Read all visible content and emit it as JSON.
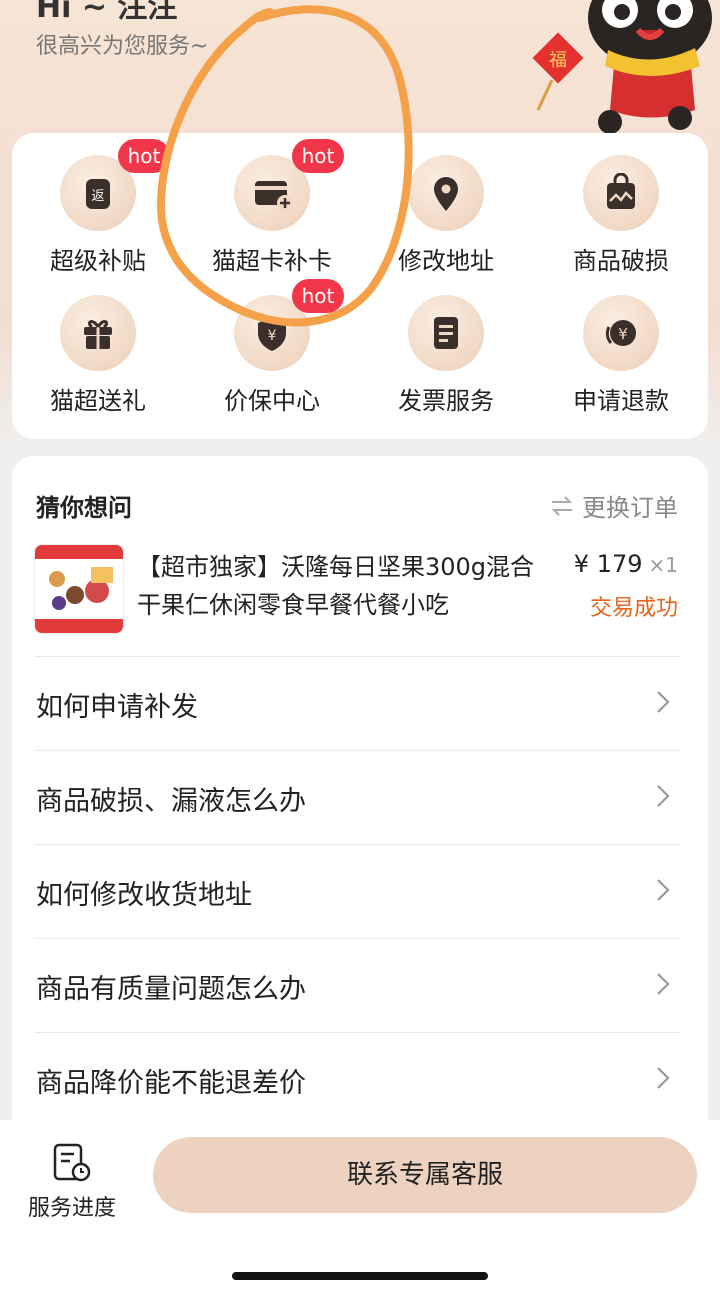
{
  "header": {
    "title_partial": "Hi  ~ 注注",
    "subtitle": "很高兴为您服务~"
  },
  "services": [
    {
      "label": "超级补贴",
      "icon": "subsidy-icon",
      "badge": "hot"
    },
    {
      "label": "猫超卡补卡",
      "icon": "card-add-icon",
      "badge": "hot"
    },
    {
      "label": "修改地址",
      "icon": "location-pin-icon",
      "badge": ""
    },
    {
      "label": "商品破损",
      "icon": "broken-bag-icon",
      "badge": ""
    },
    {
      "label": "猫超送礼",
      "icon": "gift-icon",
      "badge": ""
    },
    {
      "label": "价保中心",
      "icon": "price-protect-icon",
      "badge": "hot"
    },
    {
      "label": "发票服务",
      "icon": "invoice-icon",
      "badge": ""
    },
    {
      "label": "申请退款",
      "icon": "refund-icon",
      "badge": ""
    }
  ],
  "guess": {
    "title": "猜你想问",
    "change_label": "更换订单",
    "product": {
      "name": "【超市独家】沃隆每日坚果300g混合干果仁休闲零食早餐代餐小吃",
      "price": "¥ 179",
      "qty": "×1",
      "status": "交易成功"
    }
  },
  "faqs": [
    "如何申请补发",
    "商品破损、漏液怎么办",
    "如何修改收货地址",
    "商品有质量问题怎么办",
    "商品降价能不能退差价"
  ],
  "bottom": {
    "progress_label": "服务进度",
    "contact_label": "联系专属客服"
  },
  "colors": {
    "hot_badge": "#f2364a",
    "status_orange": "#e8631b",
    "accent_beige": "#ecd2bf",
    "annotation_orange": "#f5a14a"
  }
}
